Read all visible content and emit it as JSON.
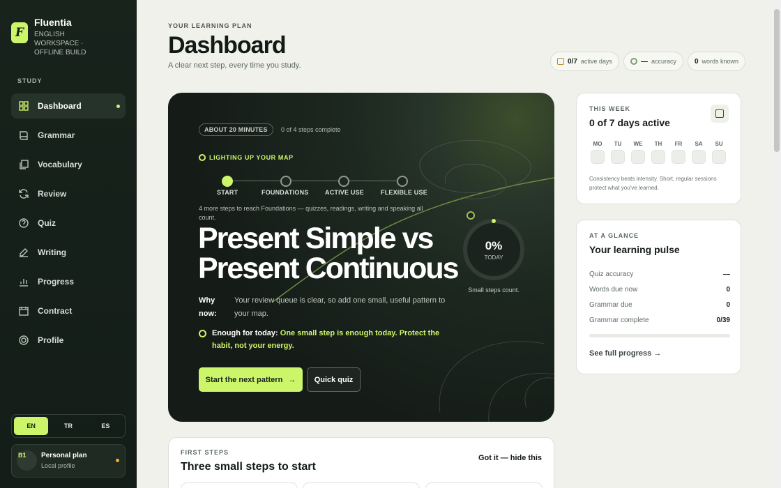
{
  "app": {
    "name": "Fluentia",
    "subtitle": "ENGLISH WORKSPACE · OFFLINE BUILD",
    "logo_letter": "F"
  },
  "sidebar": {
    "section": "STUDY",
    "items": [
      {
        "label": "Dashboard",
        "icon": "grid-icon",
        "active": true
      },
      {
        "label": "Grammar",
        "icon": "book-icon",
        "active": false
      },
      {
        "label": "Vocabulary",
        "icon": "cards-icon",
        "active": false
      },
      {
        "label": "Review",
        "icon": "refresh-icon",
        "active": false
      },
      {
        "label": "Quiz",
        "icon": "question-circle-icon",
        "active": false
      },
      {
        "label": "Writing",
        "icon": "pencil-icon",
        "active": false
      },
      {
        "label": "Progress",
        "icon": "chart-bars-icon",
        "active": false
      },
      {
        "label": "Contract",
        "icon": "calendar-icon",
        "active": false
      },
      {
        "label": "Profile",
        "icon": "target-icon",
        "active": false
      }
    ],
    "languages": [
      "EN",
      "TR",
      "ES"
    ],
    "active_language": "EN",
    "plan": {
      "level": "B1",
      "title": "Personal plan",
      "subtitle": "Local profile"
    }
  },
  "header": {
    "eyebrow": "YOUR LEARNING PLAN",
    "title": "Dashboard",
    "subtitle": "A clear next step, every time you study.",
    "stats": [
      {
        "value": "0/7",
        "label": "active days",
        "icon": "calendar-icon"
      },
      {
        "value": "—",
        "label": "accuracy",
        "icon": "target-icon"
      },
      {
        "value": "0",
        "label": "words known",
        "icon": ""
      }
    ]
  },
  "hero": {
    "time_pill": "ABOUT 20 MINUTES",
    "steps_complete": "0 of 4 steps complete",
    "map_label": "LIGHTING UP YOUR MAP",
    "steps": [
      "START",
      "FOUNDATIONS",
      "ACTIVE USE",
      "FLEXIBLE USE"
    ],
    "completed_steps": 1,
    "step_note": "4 more steps to reach Foundations — quizzes, readings, writing and speaking all count.",
    "lesson_title": "Present Simple vs Present Continuous",
    "why_label": "Why now:",
    "why_text": "Your review queue is clear, so add one small, useful pattern to your map.",
    "enough_label": "Enough for today:",
    "enough_text": "One small step is enough today. Protect the habit, not your energy.",
    "primary_button": "Start the next pattern",
    "secondary_button": "Quick quiz",
    "progress_value": "0%",
    "progress_sub": "TODAY",
    "progress_caption": "Small steps count.",
    "progress_fraction": 0
  },
  "week": {
    "eyebrow": "THIS WEEK",
    "title": "0 of 7 days active",
    "days": [
      "MO",
      "TU",
      "WE",
      "TH",
      "FR",
      "SA",
      "SU"
    ],
    "note": "Consistency beats intensity. Short, regular sessions protect what you've learned."
  },
  "pulse": {
    "eyebrow": "AT A GLANCE",
    "title": "Your learning pulse",
    "rows": [
      {
        "label": "Quiz accuracy",
        "value": "—"
      },
      {
        "label": "Words due now",
        "value": "0"
      },
      {
        "label": "Grammar due",
        "value": "0"
      },
      {
        "label": "Grammar complete",
        "value": "0/39"
      }
    ],
    "progress_fraction": 0,
    "link": "See full progress"
  },
  "first_steps": {
    "eyebrow": "FIRST STEPS",
    "title": "Three small steps to start",
    "hide_link": "Got it — hide this"
  },
  "colors": {
    "accent": "#cdf56a",
    "sidebar": "#18231c",
    "hero_dark": "#151c18"
  }
}
